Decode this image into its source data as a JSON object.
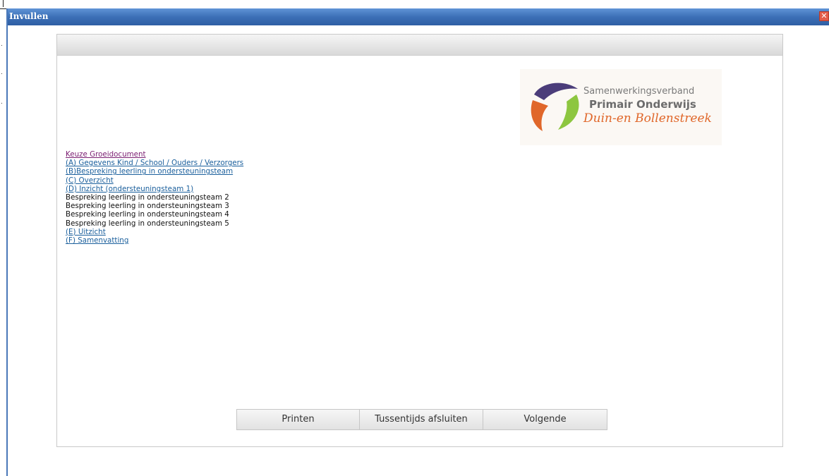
{
  "window": {
    "title": "Invullen",
    "close_glyph": "✕"
  },
  "logo": {
    "line1": "Samenwerkingsverband",
    "line2": "Primair Onderwijs",
    "line3": "Duin-en Bollenstreek",
    "colors": {
      "navy": "#4b3d7a",
      "orange": "#e0672a",
      "green": "#8dc640"
    }
  },
  "nav": {
    "items": [
      {
        "label": "Keuze Groeidocument",
        "type": "link-visited"
      },
      {
        "label": "(A) Gegevens Kind / School / Ouders / Verzorgers",
        "type": "link"
      },
      {
        "label": "(B)Bespreking leerling in ondersteuningsteam",
        "type": "link"
      },
      {
        "label": "(C) Overzicht",
        "type": "link"
      },
      {
        "label": "(D) Inzicht (ondersteuningsteam 1)",
        "type": "link"
      },
      {
        "label": "Bespreking leerling in ondersteuningsteam 2",
        "type": "text"
      },
      {
        "label": "Bespreking leerling in ondersteuningsteam 3",
        "type": "text"
      },
      {
        "label": "Bespreking leerling in ondersteuningsteam 4",
        "type": "text"
      },
      {
        "label": "Bespreking leerling in ondersteuningsteam 5",
        "type": "text"
      },
      {
        "label": "(E) Uitzicht",
        "type": "link"
      },
      {
        "label": "(F) Samenvatting",
        "type": "link"
      }
    ]
  },
  "buttons": {
    "print": "Printen",
    "interim_close": "Tussentijds afsluiten",
    "next": "Volgende"
  },
  "colors": {
    "titlebar": "#3c6fb6",
    "link": "#1a5f9c",
    "visited_link": "#7b1f72"
  }
}
